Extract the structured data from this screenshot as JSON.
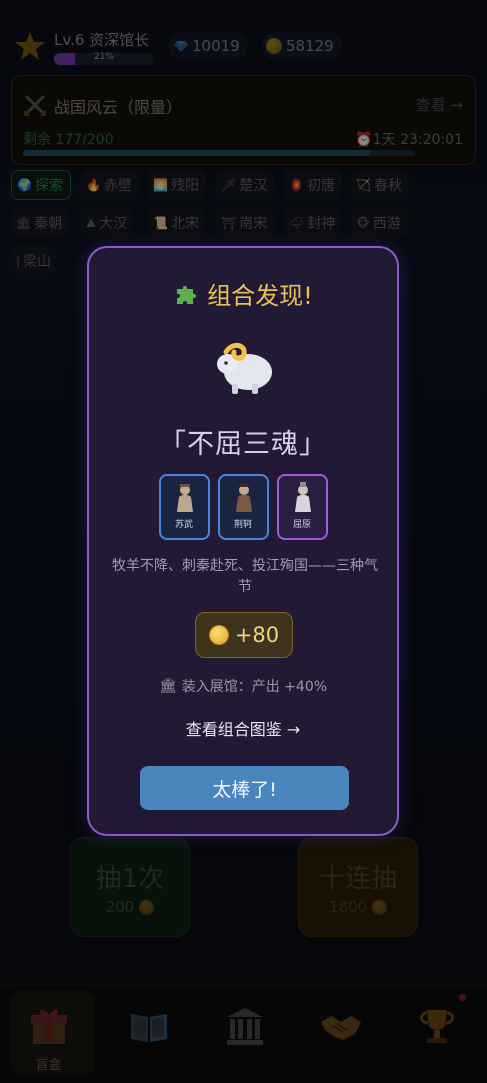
{
  "header": {
    "level_text": "Lv.6 资深馆长",
    "xp_percent_text": "21%",
    "xp_fraction": 0.21,
    "gems": "10019",
    "coins": "58129"
  },
  "event": {
    "title": "战国风云（限量）",
    "view_label": "查看 →",
    "remaining": "剩余 177/200",
    "remaining_fraction": 0.885,
    "timer": "1天 23:20:01"
  },
  "tags": [
    {
      "icon": "🌍",
      "label": "探索",
      "active": true
    },
    {
      "icon": "🔥",
      "label": "赤壁"
    },
    {
      "icon": "🌅",
      "label": "残阳"
    },
    {
      "icon": "🗡",
      "label": "楚汉"
    },
    {
      "icon": "🏮",
      "label": "初唐"
    },
    {
      "icon": "🏹",
      "label": "春秋"
    },
    {
      "icon": "🏛",
      "label": "秦朝"
    },
    {
      "icon": "⛰",
      "label": "大汉"
    },
    {
      "icon": "📜",
      "label": "北宋"
    },
    {
      "icon": "⛩",
      "label": "南宋"
    },
    {
      "icon": "🌩",
      "label": "封神"
    },
    {
      "icon": "🐵",
      "label": "西游"
    },
    {
      "icon": "|",
      "label": "梁山"
    }
  ],
  "draw": {
    "single_label": "抽1次",
    "single_cost": "200",
    "ten_label": "十连抽",
    "ten_cost": "1800"
  },
  "nav": {
    "items": [
      {
        "icon": "gift-icon",
        "label": "盲盒",
        "active": true
      },
      {
        "icon": "book-icon",
        "label": ""
      },
      {
        "icon": "museum-icon",
        "label": ""
      },
      {
        "icon": "handshake-icon",
        "label": ""
      },
      {
        "icon": "trophy-icon",
        "label": ""
      }
    ]
  },
  "modal": {
    "title": "组合发现!",
    "combo_name": "「不屈三魂」",
    "figures": [
      {
        "name": "苏武",
        "rarity_color": "#4b84d8"
      },
      {
        "name": "荆轲",
        "rarity_color": "#4b84d8"
      },
      {
        "name": "屈原",
        "rarity_color": "#a25ae0"
      }
    ],
    "description": "牧羊不降、刺秦赴死、投江殉国——三种气节",
    "reward": "+80",
    "museum_text": "装入展馆：产出 +40%",
    "catalog_link": "查看组合图鉴 →",
    "confirm_label": "太棒了!"
  },
  "colors": {
    "modal_border": "#8a5ad0",
    "modal_bg": "#221a34",
    "title_gold": "#e8c15a",
    "confirm_blue": "#4a85be"
  }
}
